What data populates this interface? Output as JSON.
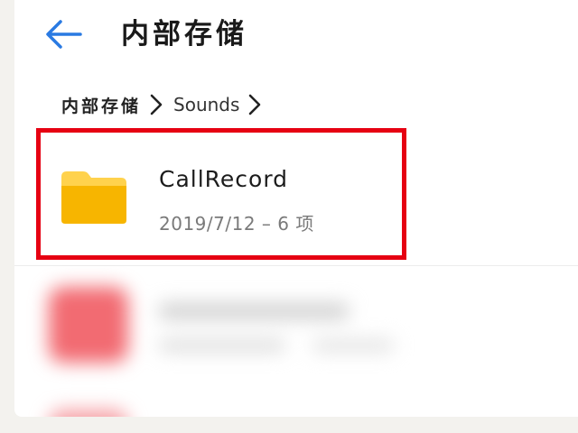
{
  "header": {
    "title": "内部存储",
    "back_icon": "arrow-left-icon"
  },
  "breadcrumb": {
    "items": [
      "内部存储",
      "Sounds"
    ],
    "separator_icon": "chevron-right-icon"
  },
  "list": {
    "items": [
      {
        "name": "CallRecord",
        "meta": "2019/7/12 – 6 项",
        "icon": "folder-icon"
      }
    ]
  },
  "colors": {
    "accent": "#2a7ae2",
    "folder": "#f7b500",
    "folder_tab": "#ffd24d",
    "highlight": "#e60012",
    "blurred_app": "#f26b72"
  }
}
